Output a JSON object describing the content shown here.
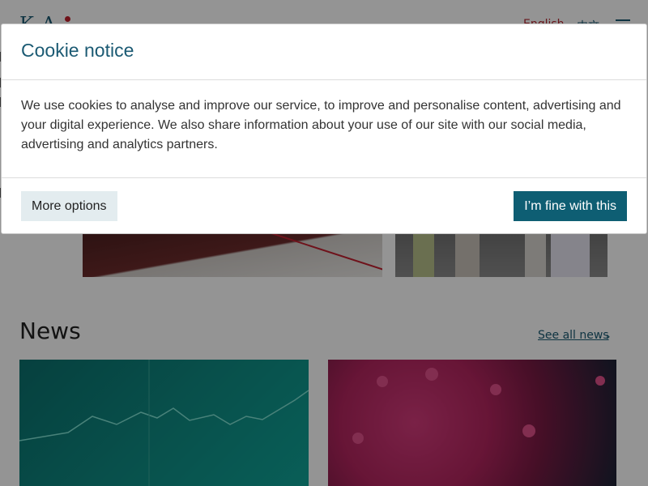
{
  "header": {
    "logo": "K  A",
    "lang_english": "English",
    "lang_chinese": "中文"
  },
  "news": {
    "title": "News",
    "see_all": "See all news"
  },
  "cookie_dialog": {
    "title": "Cookie notice",
    "body": "We use cookies to analyse and improve our service, to improve and personalise content, advertising and your digital experience. We also share information about your use of our site with our social media, advertising and analytics partners.",
    "more_options": "More options",
    "accept": "I’m fine with this"
  },
  "colors": {
    "brand": "#1b5a73",
    "accept_button": "#0e5e73",
    "more_options_bg": "#e3ecef",
    "accent_red": "#c01f2c"
  },
  "icons": [
    "menu-icon",
    "chevron-right-icon"
  ]
}
